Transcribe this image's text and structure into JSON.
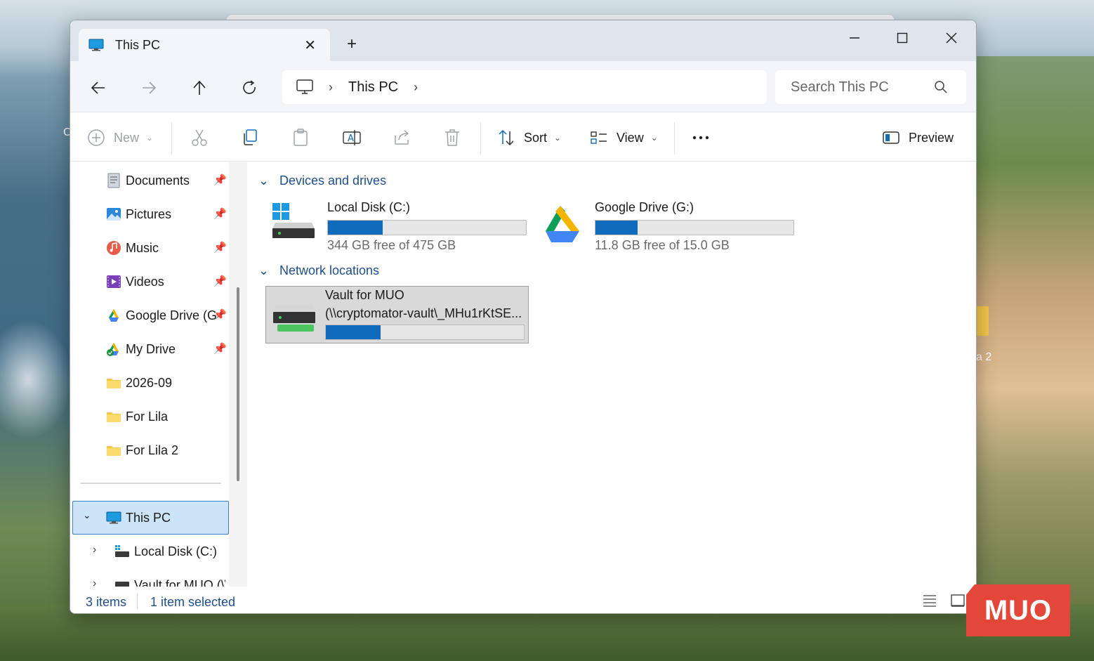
{
  "desktop": {
    "behind_label": "a 2",
    "side_letter": "C",
    "watermark": "MUO"
  },
  "window": {
    "tab_title": "This PC",
    "address": {
      "crumb": "This PC"
    },
    "search": {
      "placeholder": "Search This PC"
    }
  },
  "toolbar": {
    "new_label": "New",
    "sort_label": "Sort",
    "view_label": "View",
    "preview_label": "Preview"
  },
  "sidebar": {
    "pinned": [
      {
        "label": "Documents",
        "icon": "documents-icon"
      },
      {
        "label": "Pictures",
        "icon": "pictures-icon"
      },
      {
        "label": "Music",
        "icon": "music-icon"
      },
      {
        "label": "Videos",
        "icon": "videos-icon"
      },
      {
        "label": "Google Drive (G:)",
        "icon": "google-drive-icon"
      },
      {
        "label": "My Drive",
        "icon": "my-drive-icon"
      },
      {
        "label": "2026-09",
        "icon": "folder-icon"
      },
      {
        "label": "For Lila",
        "icon": "folder-icon"
      },
      {
        "label": "For Lila 2",
        "icon": "folder-icon"
      }
    ],
    "this_pc": "This PC",
    "children": [
      {
        "label": "Local Disk (C:)"
      },
      {
        "label": "Vault for MUO (\\\\"
      }
    ]
  },
  "main": {
    "groups": [
      {
        "title": "Devices and drives"
      },
      {
        "title": "Network locations"
      }
    ],
    "drives": [
      {
        "name": "Local Disk (C:)",
        "free": "344 GB free of 475 GB",
        "used_fraction": 0.276
      },
      {
        "name": "Google Drive (G:)",
        "free": "11.8 GB free of 15.0 GB",
        "used_fraction": 0.213
      }
    ],
    "network": [
      {
        "name": "Vault for MUO",
        "path": "(\\\\cryptomator-vault\\_MHu1rKtSE...",
        "used_fraction": 0.276
      }
    ]
  },
  "status": {
    "count": "3 items",
    "selection": "1 item selected"
  },
  "colors": {
    "accent": "#0f6cbd",
    "selection_bg": "#cce4f7",
    "group_header": "#1f4e8a"
  }
}
